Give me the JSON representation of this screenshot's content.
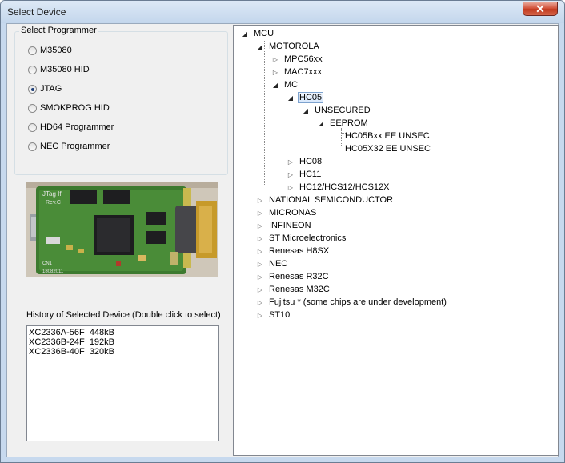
{
  "window": {
    "title": "Select Device"
  },
  "programmer": {
    "label": "Select Programmer",
    "options": [
      {
        "label": "M35080",
        "checked": false
      },
      {
        "label": "M35080 HID",
        "checked": false
      },
      {
        "label": "JTAG",
        "checked": true
      },
      {
        "label": "SMOKPROG HID",
        "checked": false
      },
      {
        "label": "HD64 Programmer",
        "checked": false
      },
      {
        "label": "NEC Programmer",
        "checked": false
      }
    ]
  },
  "board_image": {
    "silk_text": [
      "JTag If",
      "Rev.C",
      "CN1",
      "18082011"
    ]
  },
  "history": {
    "label": "History of Selected Device (Double click to select)",
    "items": [
      "XC2336A-56F  448kB",
      "XC2336B-24F  192kB",
      "XC2336B-40F  320kB"
    ]
  },
  "tree": {
    "root": "MCU",
    "motorola": "MOTOROLA",
    "mpc56xx": "MPC56xx",
    "mac7xxx": "MAC7xxx",
    "mc": "MC",
    "hc05": "HC05",
    "unsecured": "UNSECURED",
    "eeprom": "EEPROM",
    "hc05bxx": "HC05Bxx EE UNSEC",
    "hc05x32": "HC05X32 EE UNSEC",
    "hc08": "HC08",
    "hc11": "HC11",
    "hc12": "HC12/HCS12/HCS12X",
    "national": "NATIONAL SEMICONDUCTOR",
    "micronas": "MICRONAS",
    "infineon": "INFINEON",
    "st": "ST Microelectronics",
    "renesas_h8": "Renesas H8SX",
    "nec": "NEC",
    "renesas_r32": "Renesas R32C",
    "renesas_m32": "Renesas M32C",
    "fujitsu": "Fujitsu * (some chips are under development)",
    "st10": "ST10"
  },
  "colors": {
    "accent": "#1f3f7a",
    "selection": "#d5e6fb"
  }
}
